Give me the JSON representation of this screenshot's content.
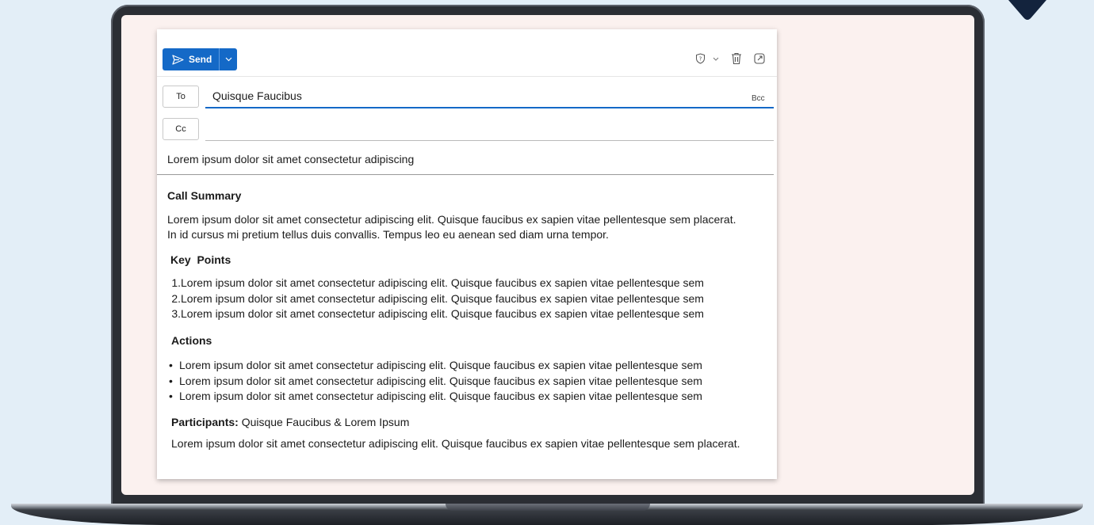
{
  "compose": {
    "send_label": "Send",
    "to_label": "To",
    "to_value": "Quisque Faucibus",
    "bcc_label": "Bcc",
    "cc_label": "Cc",
    "cc_value": "",
    "subject": "Lorem ipsum dolor sit amet consectetur adipiscing"
  },
  "body": {
    "summary_heading": "Call Summary",
    "summary_line1": "Lorem ipsum dolor sit amet consectetur adipiscing elit. Quisque faucibus ex sapien vitae pellentesque sem placerat.",
    "summary_line2": "In id cursus mi pretium tellus duis convallis. Tempus leo eu aenean sed diam urna tempor.",
    "key_points_heading": "Key  Points",
    "key_points": [
      {
        "num": "1.",
        "text": "Lorem ipsum dolor sit amet consectetur adipiscing elit. Quisque faucibus ex sapien vitae pellentesque sem"
      },
      {
        "num": "2.",
        "text": "Lorem ipsum dolor sit amet consectetur adipiscing elit. Quisque faucibus ex sapien vitae pellentesque sem"
      },
      {
        "num": "3.",
        "text": "Lorem ipsum dolor sit amet consectetur adipiscing elit. Quisque faucibus ex sapien vitae pellentesque sem"
      }
    ],
    "actions_heading": "Actions",
    "actions": [
      {
        "bullet": "•",
        "text": "Lorem ipsum dolor sit amet consectetur adipiscing elit. Quisque faucibus ex sapien vitae pellentesque sem"
      },
      {
        "bullet": "•",
        "text": "Lorem ipsum dolor sit amet consectetur adipiscing elit. Quisque faucibus ex sapien vitae pellentesque sem"
      },
      {
        "bullet": "•",
        "text": "Lorem ipsum dolor sit amet consectetur adipiscing elit. Quisque faucibus ex sapien vitae pellentesque sem"
      }
    ],
    "participants_label": "Participants:",
    "participants_value": "Quisque Faucibus & Lorem Ipsum",
    "closing": "Lorem ipsum dolor sit amet consectetur adipiscing elit. Quisque faucibus ex sapien vitae pellentesque sem placerat."
  },
  "icons": {
    "send": "send-icon",
    "dropdown": "chevron-down-icon",
    "sensitivity": "shield-icon",
    "delete": "trash-icon",
    "popout": "popout-icon"
  },
  "colors": {
    "accent": "#1469c7",
    "background": "#e3eef7",
    "screen": "#fbf1ef",
    "logo": "#13233d"
  }
}
